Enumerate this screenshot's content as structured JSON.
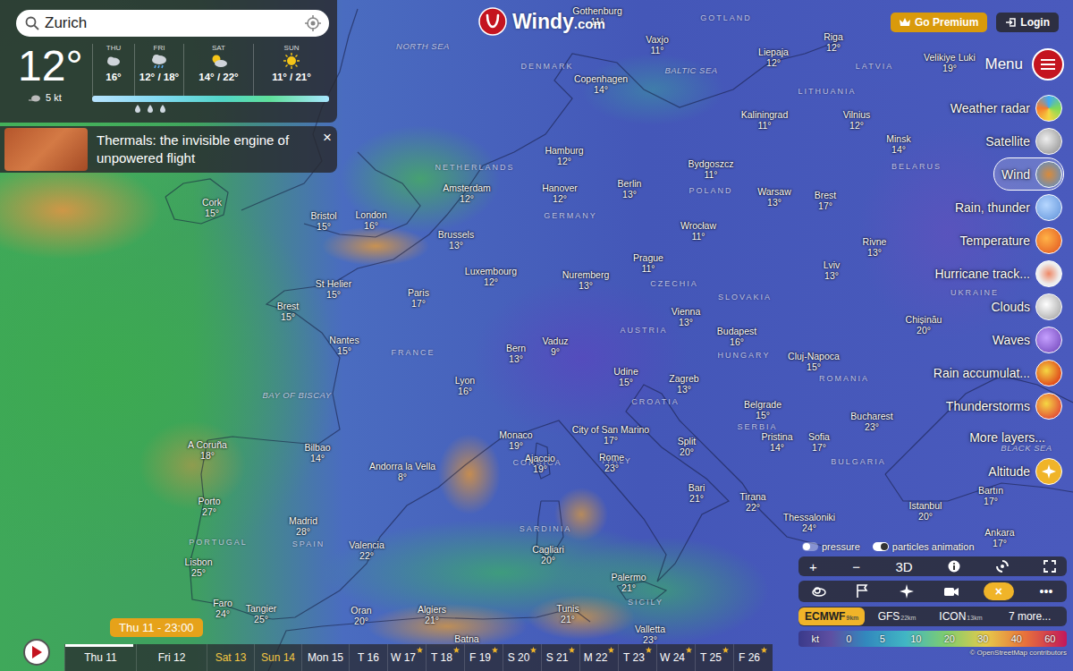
{
  "search": {
    "value": "Zurich"
  },
  "current": {
    "temp": "12°",
    "wind": "5 kt"
  },
  "forecast": [
    {
      "day": "THU",
      "temps": "16°"
    },
    {
      "day": "FRI",
      "temps": "12° / 18°"
    },
    {
      "day": "SAT",
      "temps": "14° / 22°"
    },
    {
      "day": "SUN",
      "temps": "11° / 21°"
    }
  ],
  "article": {
    "title": "Thermals: the invisible engine of unpowered flight",
    "close": "×"
  },
  "logo": {
    "name": "Windy",
    "suffix": ".com"
  },
  "header_buttons": [
    {
      "label": "Go Premium"
    },
    {
      "label": "Login"
    }
  ],
  "menu": {
    "label": "Menu"
  },
  "layers": [
    {
      "label": "Weather radar",
      "selected": false
    },
    {
      "label": "Satellite",
      "selected": false
    },
    {
      "label": "Wind",
      "selected": true
    },
    {
      "label": "Rain, thunder",
      "selected": false
    },
    {
      "label": "Temperature",
      "selected": false
    },
    {
      "label": "Hurricane track...",
      "selected": false
    },
    {
      "label": "Clouds",
      "selected": false
    },
    {
      "label": "Waves",
      "selected": false
    },
    {
      "label": "Rain accumulat...",
      "selected": false
    },
    {
      "label": "Thunderstorms",
      "selected": false
    },
    {
      "label": "More layers...",
      "selected": false
    },
    {
      "label": "Altitude",
      "selected": false
    }
  ],
  "toggles": [
    {
      "label": "pressure",
      "on": false
    },
    {
      "label": "particles animation",
      "on": true
    }
  ],
  "controls": [
    "+",
    "−",
    "3D"
  ],
  "tools": [
    {
      "kind": "icon",
      "selected": false
    },
    {
      "kind": "icon",
      "selected": false
    },
    {
      "kind": "icon",
      "selected": false
    },
    {
      "kind": "icon",
      "selected": false
    },
    {
      "kind": "glyph",
      "label": "×",
      "selected": true
    },
    {
      "kind": "glyph",
      "label": "•••",
      "selected": false
    }
  ],
  "models": [
    {
      "name": "ECMWF",
      "res": "9km",
      "selected": true
    },
    {
      "name": "GFS",
      "res": "22km",
      "selected": false
    },
    {
      "name": "ICON",
      "res": "13km",
      "selected": false
    }
  ],
  "more_models": "7 more...",
  "legend": {
    "unit": "kt",
    "ticks": [
      "0",
      "5",
      "10",
      "20",
      "30",
      "40",
      "60"
    ]
  },
  "attribution": "© OpenStreetMap contributors",
  "timeline": {
    "tooltip": "Thu 11 - 23:00",
    "days": [
      {
        "label": "Thu 11",
        "selected": true,
        "weekend": false,
        "premium": false
      },
      {
        "label": "Fri 12",
        "selected": false,
        "weekend": false,
        "premium": false
      },
      {
        "label": "Sat 13",
        "selected": false,
        "weekend": true,
        "premium": false
      },
      {
        "label": "Sun 14",
        "selected": false,
        "weekend": true,
        "premium": false
      },
      {
        "label": "Mon 15",
        "selected": false,
        "weekend": false,
        "premium": false
      },
      {
        "label": "T 16",
        "selected": false,
        "weekend": false,
        "premium": false
      },
      {
        "label": "W 17",
        "selected": false,
        "weekend": false,
        "premium": true
      },
      {
        "label": "T 18",
        "selected": false,
        "weekend": false,
        "premium": true
      },
      {
        "label": "F 19",
        "selected": false,
        "weekend": false,
        "premium": true
      },
      {
        "label": "S 20",
        "selected": false,
        "weekend": false,
        "premium": true
      },
      {
        "label": "S 21",
        "selected": false,
        "weekend": false,
        "premium": true
      },
      {
        "label": "M 22",
        "selected": false,
        "weekend": false,
        "premium": true
      },
      {
        "label": "T 23",
        "selected": false,
        "weekend": false,
        "premium": true
      },
      {
        "label": "W 24",
        "selected": false,
        "weekend": false,
        "premium": true
      },
      {
        "label": "T 25",
        "selected": false,
        "weekend": false,
        "premium": true
      },
      {
        "label": "F 26",
        "selected": false,
        "weekend": false,
        "premium": true
      }
    ]
  },
  "regions": [
    {
      "label": "NORTH SEA",
      "kind": "sea"
    },
    {
      "label": "DENMARK",
      "kind": "land"
    },
    {
      "label": "BALTIC SEA",
      "kind": "sea"
    },
    {
      "label": "GOTLAND",
      "kind": "land"
    },
    {
      "label": "LATVIA",
      "kind": "land"
    },
    {
      "label": "LITHUANIA",
      "kind": "land"
    },
    {
      "label": "BELARUS",
      "kind": "land"
    },
    {
      "label": "POLAND",
      "kind": "land"
    },
    {
      "label": "GERMANY",
      "kind": "land"
    },
    {
      "label": "NETHERLANDS",
      "kind": "land"
    },
    {
      "label": "CZECHIA",
      "kind": "land"
    },
    {
      "label": "SLOVAKIA",
      "kind": "land"
    },
    {
      "label": "UKRAINE",
      "kind": "land"
    },
    {
      "label": "AUSTRIA",
      "kind": "land"
    },
    {
      "label": "HUNGARY",
      "kind": "land"
    },
    {
      "label": "FRANCE",
      "kind": "land"
    },
    {
      "label": "ROMANIA",
      "kind": "land"
    },
    {
      "label": "CROATIA",
      "kind": "land"
    },
    {
      "label": "SERBIA",
      "kind": "land"
    },
    {
      "label": "BULGARIA",
      "kind": "land"
    },
    {
      "label": "ITALY",
      "kind": "land"
    },
    {
      "label": "CORSICA",
      "kind": "land"
    },
    {
      "label": "SARDINIA",
      "kind": "land"
    },
    {
      "label": "SPAIN",
      "kind": "land"
    },
    {
      "label": "PORTUGAL",
      "kind": "land"
    },
    {
      "label": "BAY OF BISCAY",
      "kind": "sea"
    },
    {
      "label": "SICILY",
      "kind": "land"
    },
    {
      "label": "BLACK SEA",
      "kind": "sea"
    }
  ],
  "cities": [
    {
      "name": "Gothenburg",
      "temp": "11°"
    },
    {
      "name": "Vaxjo",
      "temp": "11°"
    },
    {
      "name": "Riga",
      "temp": "12°"
    },
    {
      "name": "Liepaja",
      "temp": "12°"
    },
    {
      "name": "Velikiye Luki",
      "temp": "19°"
    },
    {
      "name": "Copenhagen",
      "temp": "14°"
    },
    {
      "name": "Kaliningrad",
      "temp": "11°"
    },
    {
      "name": "Vilnius",
      "temp": "12°"
    },
    {
      "name": "Minsk",
      "temp": "14°"
    },
    {
      "name": "Hamburg",
      "temp": "12°"
    },
    {
      "name": "Bydgoszcz",
      "temp": "11°"
    },
    {
      "name": "Berlin",
      "temp": "13°"
    },
    {
      "name": "Warsaw",
      "temp": "13°"
    },
    {
      "name": "Brest",
      "temp": "17°"
    },
    {
      "name": "Amsterdam",
      "temp": "12°"
    },
    {
      "name": "Hanover",
      "temp": "12°"
    },
    {
      "name": "Cork",
      "temp": "15°"
    },
    {
      "name": "Bristol",
      "temp": "15°"
    },
    {
      "name": "London",
      "temp": "16°"
    },
    {
      "name": "Brussels",
      "temp": "13°"
    },
    {
      "name": "Wrocław",
      "temp": "11°"
    },
    {
      "name": "Rivne",
      "temp": "13°"
    },
    {
      "name": "Luxembourg",
      "temp": "12°"
    },
    {
      "name": "Prague",
      "temp": "11°"
    },
    {
      "name": "Lviv",
      "temp": "13°"
    },
    {
      "name": "Paris",
      "temp": "17°"
    },
    {
      "name": "Nuremberg",
      "temp": "13°"
    },
    {
      "name": "St Helier",
      "temp": "15°"
    },
    {
      "name": "Brest",
      "temp": "15°"
    },
    {
      "name": "Vienna",
      "temp": "13°"
    },
    {
      "name": "Budapest",
      "temp": "16°"
    },
    {
      "name": "Chișinău",
      "temp": "20°"
    },
    {
      "name": "Nantes",
      "temp": "15°"
    },
    {
      "name": "Bern",
      "temp": "13°"
    },
    {
      "name": "Vaduz",
      "temp": "9°"
    },
    {
      "name": "Cluj-Napoca",
      "temp": "15°"
    },
    {
      "name": "Udine",
      "temp": "15°"
    },
    {
      "name": "Lyon",
      "temp": "16°"
    },
    {
      "name": "Zagreb",
      "temp": "13°"
    },
    {
      "name": "Belgrade",
      "temp": "15°"
    },
    {
      "name": "Bucharest",
      "temp": "23°"
    },
    {
      "name": "Monaco",
      "temp": "19°"
    },
    {
      "name": "City of San Marino",
      "temp": "17°"
    },
    {
      "name": "Pristina",
      "temp": "14°"
    },
    {
      "name": "Sofia",
      "temp": "17°"
    },
    {
      "name": "Split",
      "temp": "20°"
    },
    {
      "name": "A Coruña",
      "temp": "18°"
    },
    {
      "name": "Bilbao",
      "temp": "14°"
    },
    {
      "name": "Ajaccio",
      "temp": "19°"
    },
    {
      "name": "Rome",
      "temp": "23°"
    },
    {
      "name": "Andorra la Vella",
      "temp": "8°"
    },
    {
      "name": "Bari",
      "temp": "21°"
    },
    {
      "name": "Bartın",
      "temp": "17°"
    },
    {
      "name": "Tirana",
      "temp": "22°"
    },
    {
      "name": "Porto",
      "temp": "27°"
    },
    {
      "name": "Istanbul",
      "temp": "20°"
    },
    {
      "name": "Thessaloniki",
      "temp": "24°"
    },
    {
      "name": "Madrid",
      "temp": "28°"
    },
    {
      "name": "Cagliari",
      "temp": "20°"
    },
    {
      "name": "Valencia",
      "temp": "22°"
    },
    {
      "name": "Ankara",
      "temp": "17°"
    },
    {
      "name": "Lisbon",
      "temp": "25°"
    },
    {
      "name": "Palermo",
      "temp": "21°"
    },
    {
      "name": "Faro",
      "temp": "24°"
    },
    {
      "name": "Tangier",
      "temp": "25°"
    },
    {
      "name": "Algiers",
      "temp": "21°"
    },
    {
      "name": "Oran",
      "temp": "20°"
    },
    {
      "name": "Tunis",
      "temp": "21°"
    },
    {
      "name": "Valletta",
      "temp": "23°"
    },
    {
      "name": "Batna"
    }
  ]
}
